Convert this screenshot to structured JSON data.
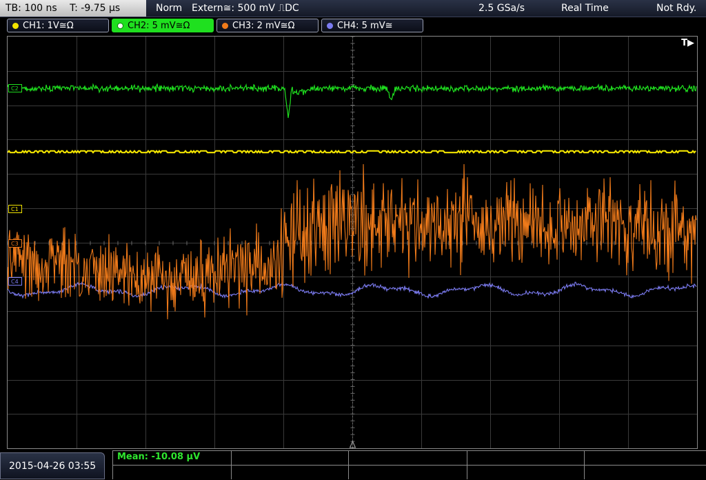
{
  "status": {
    "timebase": "TB: 100 ns",
    "trigger_time": "T: -9.75 µs",
    "mode": "Norm",
    "trigger_source": "Extern≅: 500 mV ⎍DC",
    "sample_rate": "2.5 GSa/s",
    "acquisition": "Real Time",
    "ready_state": "Not Rdy."
  },
  "channels": [
    {
      "label": "CH1: 1V≅Ω",
      "color": "#f2e400",
      "active": false
    },
    {
      "label": "CH2: 5 mV≅Ω",
      "color": "#1fe01f",
      "active": true
    },
    {
      "label": "CH3: 2 mV≅Ω",
      "color": "#ef7a1a",
      "active": false
    },
    {
      "label": "CH4: 5 mV≅",
      "color": "#7b7bf0",
      "active": false
    }
  ],
  "markers": {
    "c1": "C1",
    "c2": "C2",
    "c3": "C3",
    "c4": "C4",
    "trigger": "T▶"
  },
  "footer": {
    "timestamp": "2015-04-26 03:55",
    "measurement": "Mean: -10.08 µV"
  },
  "colors": {
    "grid": "#3a3a3a",
    "grid_center": "#6a6a6a",
    "ch1": "#f2e400",
    "ch2": "#1fe01f",
    "ch3": "#ef7a1a",
    "ch4": "#7b7bf0"
  }
}
